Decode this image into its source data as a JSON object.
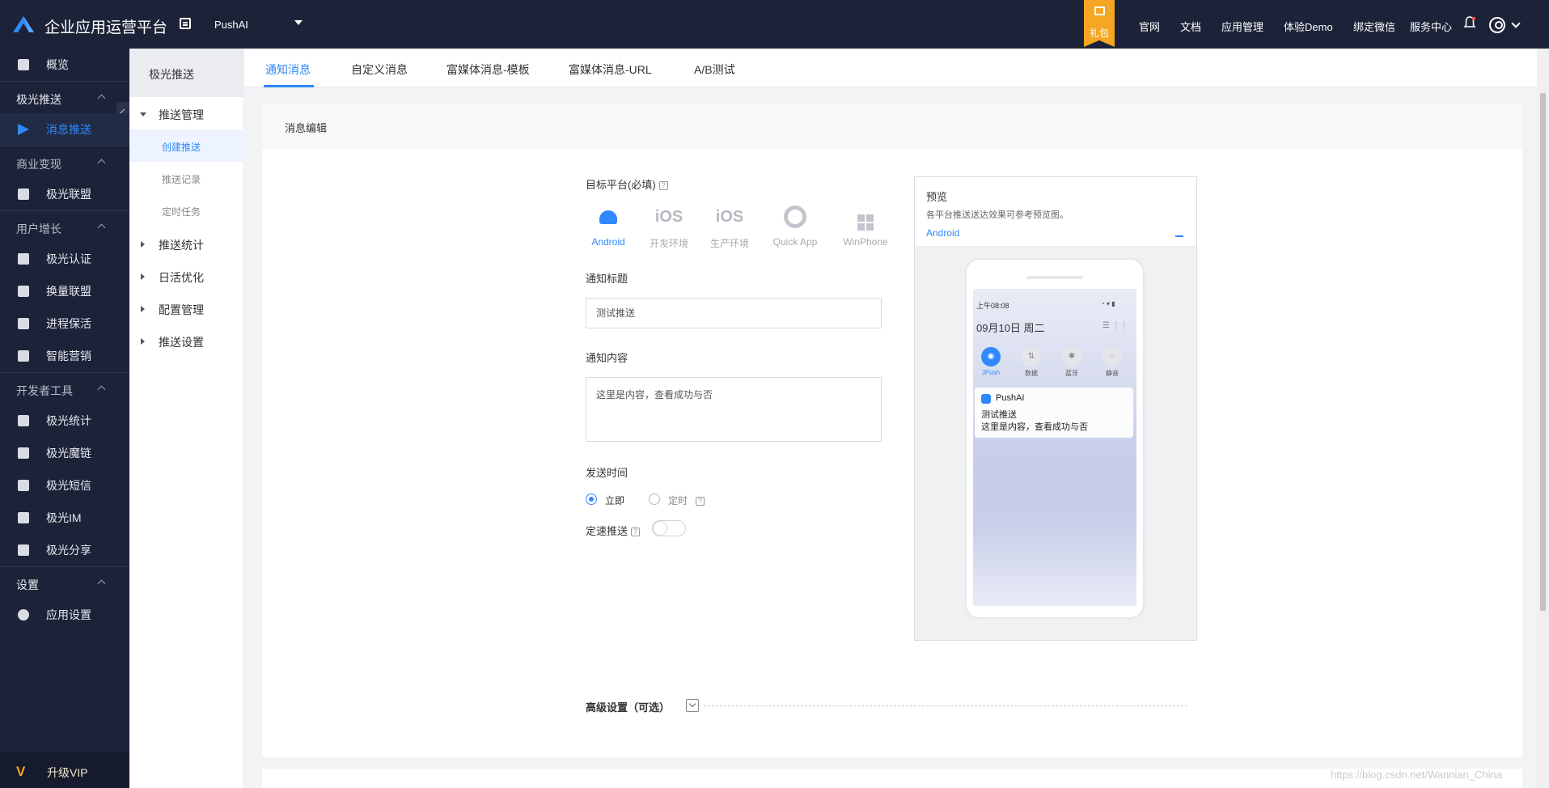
{
  "header": {
    "brand": "企业应用运营平台",
    "app_name": "PushAI",
    "gift_label": "礼包",
    "nav": [
      "官网",
      "文档",
      "应用管理",
      "体验Demo",
      "绑定微信",
      "服务中心"
    ]
  },
  "sidebar": {
    "overview": "概览",
    "sections": [
      {
        "title": "极光推送",
        "items": [
          "消息推送"
        ]
      },
      {
        "title": "商业变现",
        "items": [
          "极光联盟"
        ]
      },
      {
        "title": "用户增长",
        "items": [
          "极光认证",
          "换量联盟",
          "进程保活",
          "智能营销"
        ]
      },
      {
        "title": "开发者工具",
        "items": [
          "极光统计",
          "极光魔链",
          "极光短信",
          "极光IM",
          "极光分享"
        ]
      },
      {
        "title": "设置",
        "items": [
          "应用设置"
        ]
      }
    ],
    "upgrade": "升级VIP"
  },
  "subsidebar": {
    "title": "极光推送",
    "groups": [
      "推送管理",
      "推送统计",
      "日活优化",
      "配置管理",
      "推送设置"
    ],
    "push_items": [
      "创建推送",
      "推送记录",
      "定时任务"
    ]
  },
  "tabs": [
    "通知消息",
    "自定义消息",
    "富媒体消息-模板",
    "富媒体消息-URL",
    "A/B测试"
  ],
  "form": {
    "section_title": "消息编辑",
    "platform_label": "目标平台(必填)",
    "platforms": [
      {
        "name": "Android",
        "icon": "android-icon"
      },
      {
        "name": "开发环境",
        "icon": "iOS"
      },
      {
        "name": "生产环境",
        "icon": "iOS"
      },
      {
        "name": "Quick App",
        "icon": "quickapp-icon"
      },
      {
        "name": "WinPhone",
        "icon": "windows-icon"
      }
    ],
    "title_label": "通知标题",
    "title_value": "测试推送",
    "content_label": "通知内容",
    "content_value": "这里是内容，查看成功与否",
    "send_time_label": "发送时间",
    "send_now": "立即",
    "send_scheduled": "定时",
    "rate_label": "定速推送",
    "advanced": "高级设置（可选）"
  },
  "preview": {
    "title": "预览",
    "subtitle": "各平台推送送达效果可参考预览图。",
    "platform": "Android",
    "status_time": "上午08:08",
    "date": "09月10日  周二",
    "quick_settings": [
      "JPush",
      "数据",
      "蓝牙",
      "静音"
    ],
    "notif_app": "PushAI",
    "notif_title": "测试推送",
    "notif_body": "这里是内容，查看成功与否"
  },
  "watermark": "https://blog.csdn.net/Wannian_China"
}
